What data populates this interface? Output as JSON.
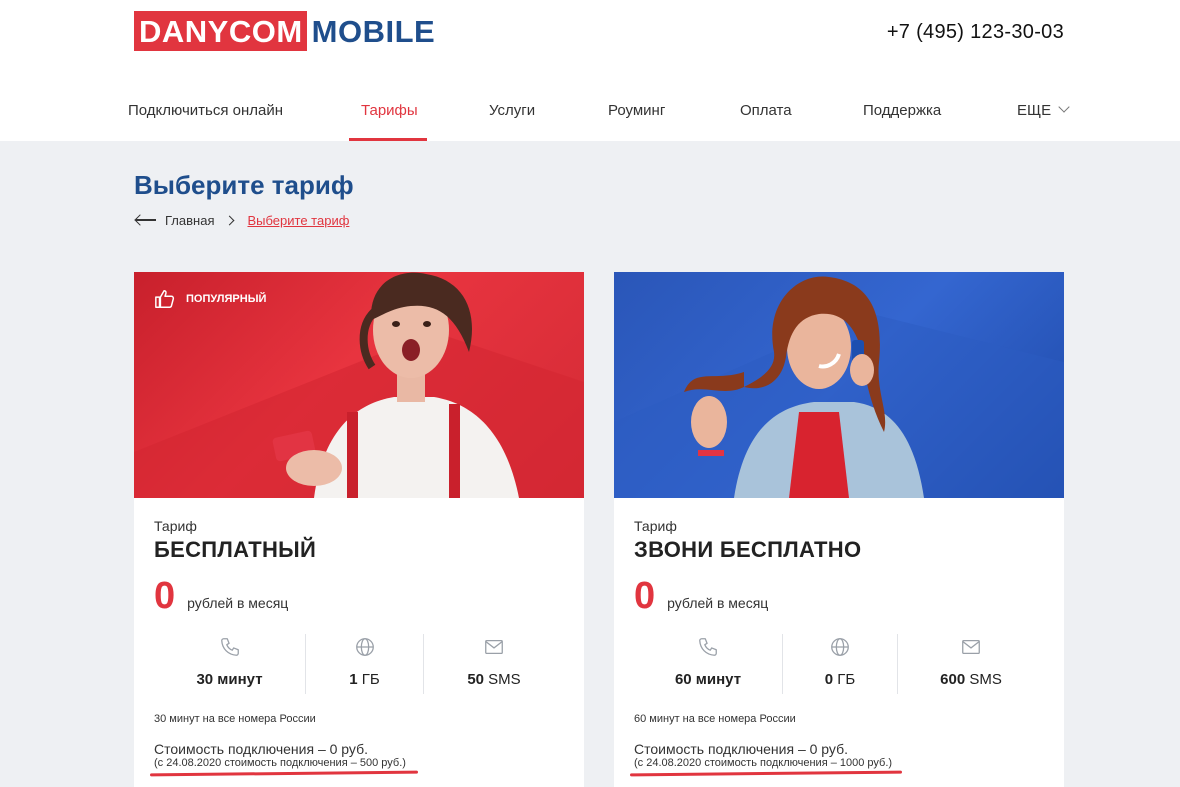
{
  "header": {
    "logo_left": "DANYCOM",
    "logo_right": "MOBILE",
    "phone": "+7 (495) 123-30-03"
  },
  "nav": {
    "items": [
      {
        "label": "Подключиться онлайн"
      },
      {
        "label": "Тарифы",
        "active": true
      },
      {
        "label": "Услуги"
      },
      {
        "label": "Роуминг"
      },
      {
        "label": "Оплата"
      },
      {
        "label": "Поддержка"
      },
      {
        "label": "ЕЩЕ"
      }
    ]
  },
  "page": {
    "title": "Выберите тариф",
    "breadcrumb": {
      "home": "Главная",
      "current": "Выберите тариф"
    }
  },
  "cards": [
    {
      "badge": "ПОПУЛЯРНЫЙ",
      "tariff_word": "Тариф",
      "name": "БЕСПЛАТНЫЙ",
      "price": "0",
      "price_unit": "рублей в месяц",
      "features": [
        {
          "icon": "phone-icon",
          "value": "30",
          "unit": "минут"
        },
        {
          "icon": "globe-icon",
          "value": "1",
          "unit": "ГБ"
        },
        {
          "icon": "mail-icon",
          "value": "50",
          "unit": "SMS"
        }
      ],
      "note": "30 минут на все номера России",
      "cost": "Стоимость подключения – 0 руб.",
      "cost_sub": "(с 24.08.2020 стоимость подключения – 500 руб.)"
    },
    {
      "tariff_word": "Тариф",
      "name": "ЗВОНИ БЕСПЛАТНО",
      "price": "0",
      "price_unit": "рублей в месяц",
      "features": [
        {
          "icon": "phone-icon",
          "value": "60",
          "unit": "минут"
        },
        {
          "icon": "globe-icon",
          "value": "0",
          "unit": "ГБ"
        },
        {
          "icon": "mail-icon",
          "value": "600",
          "unit": "SMS"
        }
      ],
      "note": "60 минут на все номера России",
      "cost": "Стоимость подключения – 0 руб.",
      "cost_sub": "(с 24.08.2020 стоимость подключения – 1000 руб.)"
    }
  ],
  "colors": {
    "accent_red": "#e1353f",
    "brand_blue": "#1f4e8c"
  }
}
